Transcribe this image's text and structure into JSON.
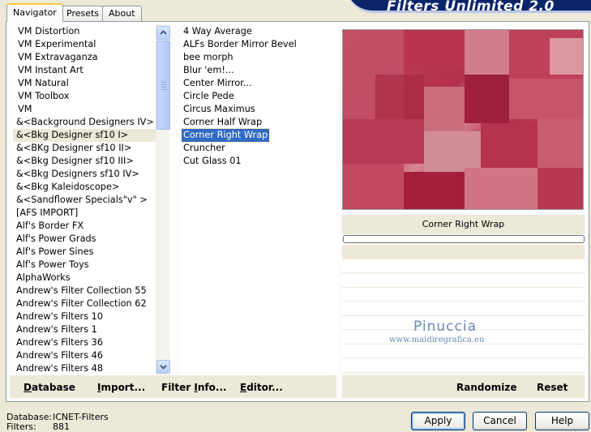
{
  "header": {
    "title": "Filters Unlimited 2.0"
  },
  "tabs": [
    {
      "label": "Navigator",
      "active": true
    },
    {
      "label": "Presets",
      "active": false
    },
    {
      "label": "About",
      "active": false
    }
  ],
  "categories": [
    "VM Distortion",
    "VM Experimental",
    "VM Extravaganza",
    "VM Instant Art",
    "VM Natural",
    "VM Toolbox",
    "VM",
    "&<Background Designers IV>",
    "&<Bkg Designer sf10 I>",
    "&<BKg Designer sf10 II>",
    "&<Bkg Designer sf10 III>",
    "&<Bkg Designers sf10 IV>",
    "&<Bkg Kaleidoscope>",
    "&<Sandflower Specials\"v\" >",
    "[AFS IMPORT]",
    "Alf's Border FX",
    "Alf's Power Grads",
    "Alf's Power Sines",
    "Alf's Power Toys",
    "AlphaWorks",
    "Andrew's Filter Collection 55",
    "Andrew's Filter Collection 62",
    "Andrew's Filters 10",
    "Andrew's Filters 1",
    "Andrew's Filters 36",
    "Andrew's Filters 46",
    "Andrew's Filters 48"
  ],
  "filters": [
    "4 Way Average",
    "ALFs Border Mirror Bevel",
    "bee morph",
    "Blur 'em!...",
    "Center Mirror...",
    "Circle Pede",
    "Circus Maximus",
    "Corner Half Wrap",
    "Corner Right Wrap",
    "Cruncher",
    "Cut Glass 01"
  ],
  "selected_filter_name": "Corner Right Wrap",
  "left_buttons": {
    "database": "Database",
    "import": "Import...",
    "filter_info": "Filter Info...",
    "editor": "Editor..."
  },
  "right_buttons": {
    "randomize": "Randomize",
    "reset": "Reset"
  },
  "status": {
    "database_label": "Database:",
    "database_value": "ICNET-Filters",
    "filters_label": "Filters:",
    "filters_value": "881"
  },
  "dialog_buttons": {
    "apply": "Apply",
    "cancel": "Cancel",
    "help": "Help"
  },
  "watermark": {
    "name": "Pinuccia",
    "url": "www.maidiregrafica.eu"
  }
}
